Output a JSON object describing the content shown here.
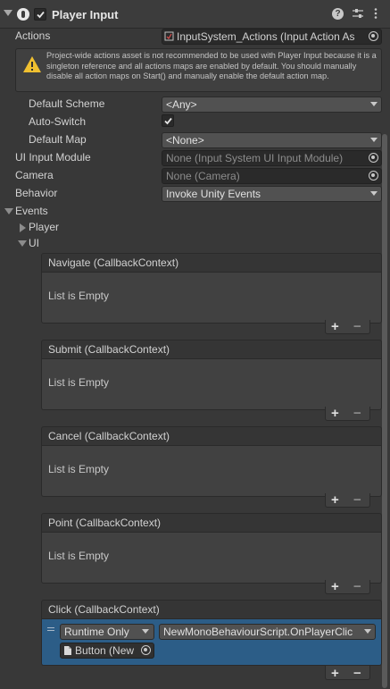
{
  "component": {
    "title": "Player Input",
    "enabled": true
  },
  "actions": {
    "label": "Actions",
    "value": "InputSystem_Actions (Input Action As"
  },
  "warning": {
    "text": "Project-wide actions asset is not recommended to be used with Player Input because it is a singleton reference and all actions maps are enabled by default. You should manually disable all action maps on Start() and manually enable the default action map."
  },
  "fields": {
    "default_scheme": {
      "label": "Default Scheme",
      "value": "<Any>"
    },
    "auto_switch": {
      "label": "Auto-Switch",
      "checked": true
    },
    "default_map": {
      "label": "Default Map",
      "value": "<None>"
    },
    "ui_input_module": {
      "label": "UI Input Module",
      "value": "None (Input System UI Input Module)"
    },
    "camera": {
      "label": "Camera",
      "value": "None (Camera)"
    },
    "behavior": {
      "label": "Behavior",
      "value": "Invoke Unity Events"
    }
  },
  "events": {
    "label": "Events",
    "player_label": "Player",
    "ui_label": "UI",
    "list_empty_text": "List is Empty",
    "items": [
      {
        "name": "Navigate (CallbackContext)"
      },
      {
        "name": "Submit (CallbackContext)"
      },
      {
        "name": "Cancel (CallbackContext)"
      },
      {
        "name": "Point (CallbackContext)"
      },
      {
        "name": "Click (CallbackContext)"
      }
    ],
    "click_entry": {
      "mode": "Runtime Only",
      "function": "NewMonoBehaviourScript.OnPlayerClic",
      "target": "Button (New"
    },
    "add_symbol": "+",
    "remove_symbol": "−"
  },
  "colors": {
    "background": "#383838",
    "selected_row": "#2c5d87",
    "warning_yellow": "#f0c030"
  }
}
